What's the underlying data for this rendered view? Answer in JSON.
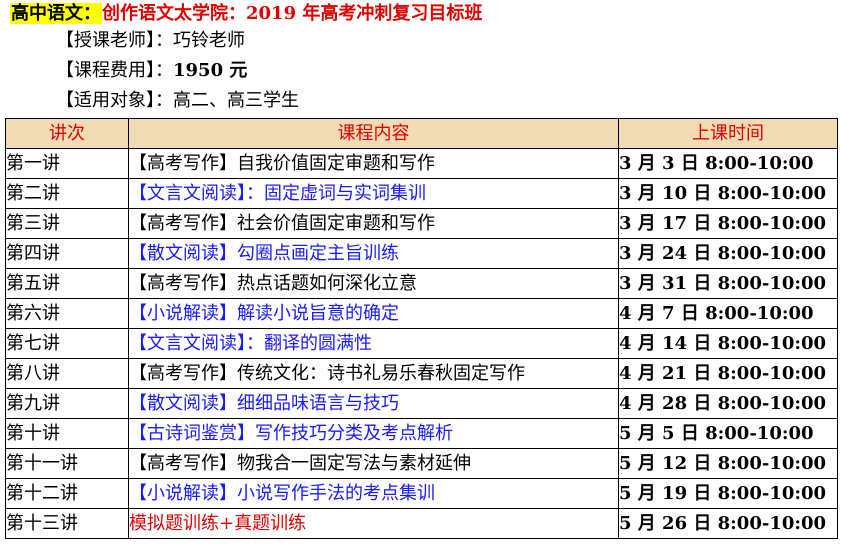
{
  "header": {
    "title_label": "高中语文：",
    "title_text": "创作语文太学院：2019 年高考冲刺复习目标班",
    "teacher_label": "【授课老师】：",
    "teacher_value": "巧铃老师",
    "fee_label": "【课程费用】：",
    "fee_value": "1950 元",
    "audience_label": "【适用对象】：",
    "audience_value": "高二、高三学生"
  },
  "table": {
    "headers": [
      "讲次",
      "课程内容",
      "上课时间"
    ],
    "rows": [
      {
        "lesson": "第一讲",
        "content": "【高考写作】自我价值固定审题和写作",
        "time": "3 月 3 日 8:00-10:00",
        "color": "black"
      },
      {
        "lesson": "第二讲",
        "content": "【文言文阅读】：固定虚词与实词集训",
        "time": "3 月 10 日 8:00-10:00",
        "color": "blue"
      },
      {
        "lesson": "第三讲",
        "content": "【高考写作】社会价值固定审题和写作",
        "time": "3 月 17 日 8:00-10:00",
        "color": "black"
      },
      {
        "lesson": "第四讲",
        "content": "【散文阅读】勾圈点画定主旨训练",
        "time": "3 月 24 日 8:00-10:00",
        "color": "blue"
      },
      {
        "lesson": "第五讲",
        "content": "【高考写作】热点话题如何深化立意",
        "time": "3 月 31 日 8:00-10:00",
        "color": "black"
      },
      {
        "lesson": "第六讲",
        "content": "【小说解读】解读小说旨意的确定",
        "time": "4 月 7 日 8:00-10:00",
        "color": "blue"
      },
      {
        "lesson": "第七讲",
        "content": "【文言文阅读】：翻译的圆满性",
        "time": "4 月 14 日 8:00-10:00",
        "color": "blue"
      },
      {
        "lesson": "第八讲",
        "content": "【高考写作】传统文化：诗书礼易乐春秋固定写作",
        "time": "4 月 21 日 8:00-10:00",
        "color": "black"
      },
      {
        "lesson": "第九讲",
        "content": "【散文阅读】细细品味语言与技巧",
        "time": "4 月 28 日 8:00-10:00",
        "color": "blue"
      },
      {
        "lesson": "第十讲",
        "content": "【古诗词鉴赏】写作技巧分类及考点解析",
        "time": "5 月 5 日 8:00-10:00",
        "color": "blue"
      },
      {
        "lesson": "第十一讲",
        "content": "【高考写作】物我合一固定写法与素材延伸",
        "time": "5 月 12 日 8:00-10:00",
        "color": "black"
      },
      {
        "lesson": "第十二讲",
        "content": "【小说解读】小说写作手法的考点集训",
        "time": "5 月 19 日 8:00-10:00",
        "color": "blue"
      },
      {
        "lesson": "第十三讲",
        "content": "模拟题训练+真题训练",
        "time": "5 月 26 日 8:00-10:00",
        "color": "red"
      }
    ]
  },
  "colors": {
    "highlight": "#ffff00",
    "title_red": "#e00000",
    "header_bg": "#f2dcb4",
    "blue_text": "#1a1aff"
  }
}
